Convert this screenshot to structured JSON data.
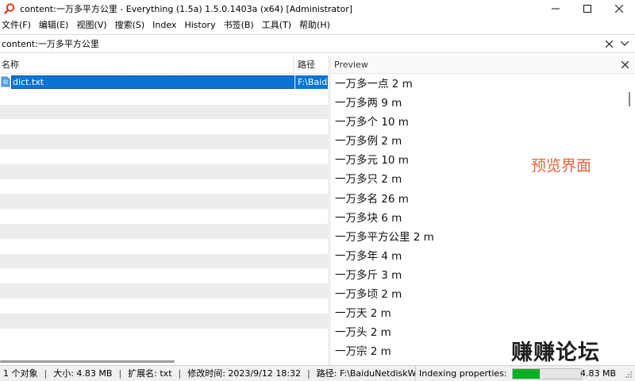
{
  "window": {
    "title": "content:一万多平方公里 - Everything (1.5a) 1.5.0.1403a (x64) [Administrator]"
  },
  "menu": [
    "文件(F)",
    "编辑(E)",
    "视图(V)",
    "搜索(S)",
    "Index",
    "History",
    "书签(B)",
    "工具(T)",
    "帮助(H)"
  ],
  "search": {
    "value": "content:一万多平方公里"
  },
  "results": {
    "columns": {
      "name": "名称",
      "path": "路径"
    },
    "selected": {
      "name": "dict.txt",
      "path": "F:\\BaiduNetdiskWorkspace"
    }
  },
  "preview": {
    "title": "Preview",
    "lines": [
      "一万多一点 2 m",
      "一万多两 9 m",
      "一万多个 10 m",
      "一万多例 2 m",
      "一万多元 10 m",
      "一万多只 2 m",
      "一万多名 26 m",
      "一万多块 6 m",
      "一万多平方公里 2 m",
      "一万多年 4 m",
      "一万多斤 3 m",
      "一万多顷 2 m",
      "一万天 2 m",
      "一万头 2 m",
      "一万宗 2 m"
    ],
    "annotation": "预览界面",
    "watermark": "赚赚论坛"
  },
  "status": {
    "count": "1 个对象",
    "size": "大小: 4.83 MB",
    "ext": "扩展名: txt",
    "modified": "修改时间: 2023/9/12 18:32",
    "path": "路径: F:\\BaiduNetdiskWorkspace",
    "indexing_label": "Indexing properties:",
    "indexing_progress": 0.4,
    "indexing_size": "4.83 MB"
  },
  "colors": {
    "selection": "#0a74d4",
    "progress": "#06b025",
    "annotation": "#e8613d"
  }
}
